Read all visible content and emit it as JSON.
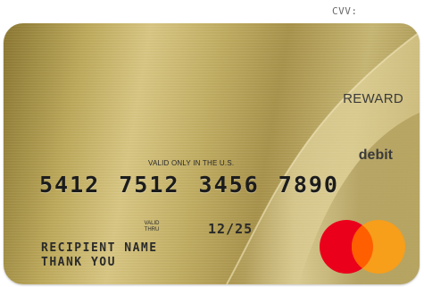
{
  "cvv_label": "CVV:",
  "card": {
    "reward_label": "REWARD",
    "debit_label": "debit",
    "valid_only_text": "VALID ONLY IN THE U.S.",
    "number": "5412 7512 3456 7890",
    "valid_thru_line1": "VALID",
    "valid_thru_line2": "THRU",
    "expiry": "12/25",
    "recipient_line1": "RECIPIENT NAME",
    "recipient_line2": "THANK YOU",
    "network_logo": "mastercard-logo"
  },
  "colors": {
    "card_gold": "#bda95a",
    "mc_red": "#eb001b",
    "mc_orange": "#f79e1b",
    "mc_overlap": "#ff5f00"
  }
}
